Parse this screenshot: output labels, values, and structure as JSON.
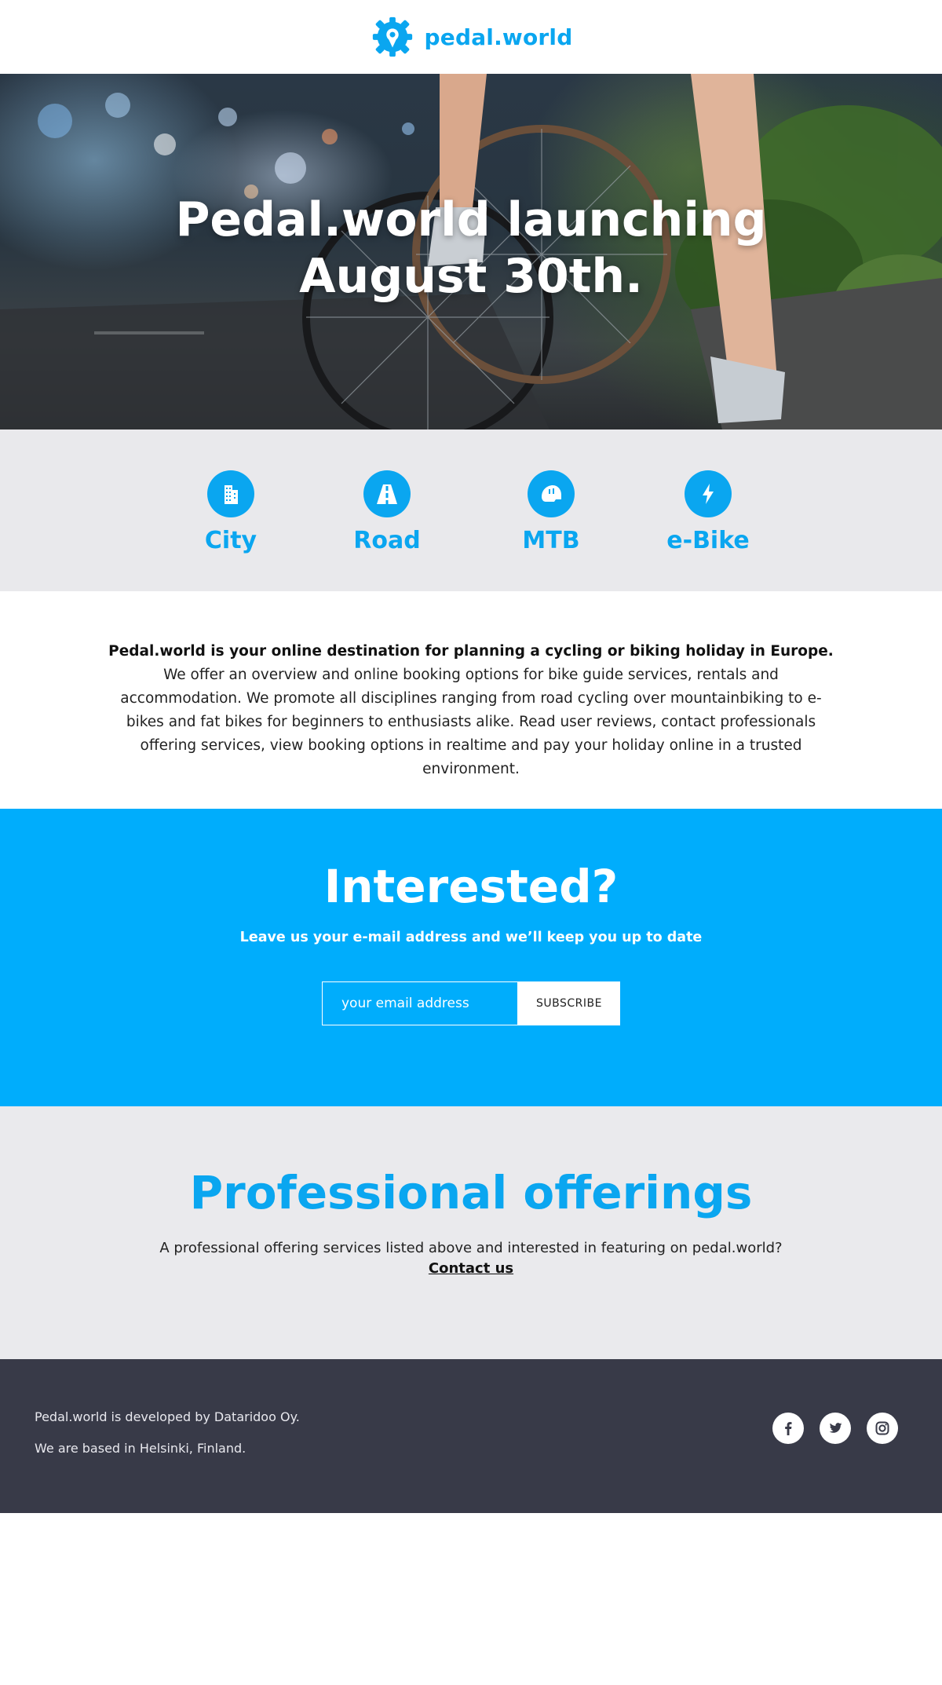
{
  "brand": {
    "name": "pedal.world",
    "color": "#0aa6f0",
    "icon": "gear-pin-logo-icon"
  },
  "hero": {
    "title_line1": "Pedal.world launching",
    "title_line2": "August 30th."
  },
  "categories": [
    {
      "label": "City",
      "icon": "building-icon"
    },
    {
      "label": "Road",
      "icon": "road-icon"
    },
    {
      "label": "MTB",
      "icon": "helmet-icon"
    },
    {
      "label": "e-Bike",
      "icon": "lightning-icon"
    }
  ],
  "about": {
    "lead": "Pedal.world is your online destination for planning a cycling or biking holiday in Europe.",
    "body": " We offer an overview and online booking options for bike guide services, rentals and accommodation. We promote all disciplines ranging from road cycling over mountainbiking to e-bikes and fat bikes for beginners to enthusiasts alike. Read user reviews, contact professionals offering services, view booking options in realtime and pay your holiday online in a trusted environment."
  },
  "newsletter": {
    "title": "Interested?",
    "subtitle": "Leave us your e-mail address and we’ll keep you up to date",
    "email_placeholder": "your email address",
    "email_value": "",
    "button_label": "SUBSCRIBE",
    "background": "#00adfc"
  },
  "professional": {
    "title": "Professional offerings",
    "text": "A professional offering services listed above and interested in featuring on pedal.world?",
    "link_label": "Contact us"
  },
  "footer": {
    "line1": "Pedal.world is developed by Dataridoo Oy.",
    "line2": "We are based in Helsinki, Finland.",
    "background": "#383a48",
    "socials": [
      "facebook-icon",
      "twitter-icon",
      "instagram-icon"
    ]
  }
}
